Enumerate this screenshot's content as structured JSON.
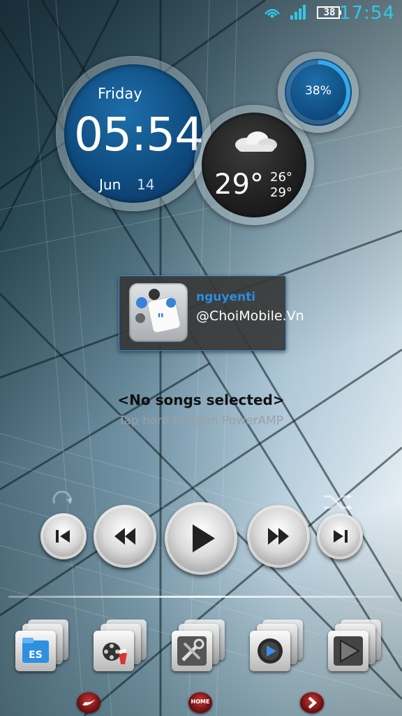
{
  "status_bar": {
    "battery_level": "38",
    "time": "17:54",
    "accent_color": "#31c8e6"
  },
  "clock_widget": {
    "day": "Friday",
    "time": "05:54",
    "month": "Jun",
    "date": "14"
  },
  "weather_widget": {
    "icon": "cloud-icon",
    "current_temp": "29°",
    "high_temp": "26°",
    "low_temp": "29°"
  },
  "battery_widget": {
    "percent_label": "38%",
    "level": 0.38
  },
  "twitter_widget": {
    "username": "nguyenti",
    "text": "@ChoiMobile.Vn",
    "border_color": "#3a8fd8"
  },
  "music_player": {
    "title": "<No songs selected>",
    "subtitle": "Tap here to open PowerAMP",
    "controls": [
      "repeat-icon",
      "previous-track",
      "rewind",
      "play",
      "fast-forward",
      "next-track",
      "shuffle-icon"
    ]
  },
  "dock": {
    "apps": [
      "file-manager-icon",
      "movie-icon",
      "tools-icon",
      "media-player-icon",
      "play-store-icon"
    ]
  },
  "nav_bar": {
    "home_label": "HOME"
  }
}
